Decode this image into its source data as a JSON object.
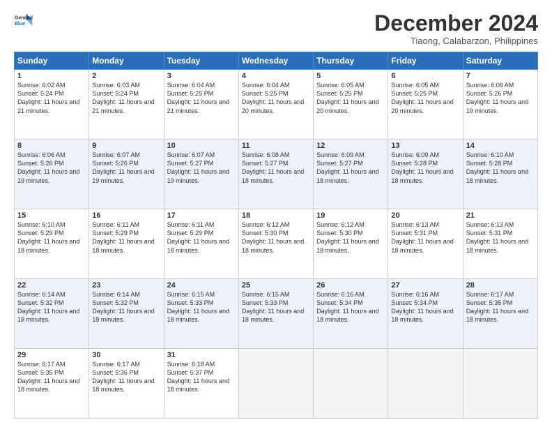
{
  "logo": {
    "line1": "General",
    "line2": "Blue"
  },
  "title": "December 2024",
  "subtitle": "Tiaong, Calabarzon, Philippines",
  "headers": [
    "Sunday",
    "Monday",
    "Tuesday",
    "Wednesday",
    "Thursday",
    "Friday",
    "Saturday"
  ],
  "weeks": [
    [
      {
        "day": "1",
        "sunrise": "6:02 AM",
        "sunset": "5:24 PM",
        "daylight": "11 hours and 21 minutes."
      },
      {
        "day": "2",
        "sunrise": "6:03 AM",
        "sunset": "5:24 PM",
        "daylight": "11 hours and 21 minutes."
      },
      {
        "day": "3",
        "sunrise": "6:04 AM",
        "sunset": "5:25 PM",
        "daylight": "11 hours and 21 minutes."
      },
      {
        "day": "4",
        "sunrise": "6:04 AM",
        "sunset": "5:25 PM",
        "daylight": "11 hours and 20 minutes."
      },
      {
        "day": "5",
        "sunrise": "6:05 AM",
        "sunset": "5:25 PM",
        "daylight": "11 hours and 20 minutes."
      },
      {
        "day": "6",
        "sunrise": "6:05 AM",
        "sunset": "5:25 PM",
        "daylight": "11 hours and 20 minutes."
      },
      {
        "day": "7",
        "sunrise": "6:06 AM",
        "sunset": "5:26 PM",
        "daylight": "11 hours and 19 minutes."
      }
    ],
    [
      {
        "day": "8",
        "sunrise": "6:06 AM",
        "sunset": "5:26 PM",
        "daylight": "11 hours and 19 minutes."
      },
      {
        "day": "9",
        "sunrise": "6:07 AM",
        "sunset": "5:26 PM",
        "daylight": "11 hours and 19 minutes."
      },
      {
        "day": "10",
        "sunrise": "6:07 AM",
        "sunset": "5:27 PM",
        "daylight": "11 hours and 19 minutes."
      },
      {
        "day": "11",
        "sunrise": "6:08 AM",
        "sunset": "5:27 PM",
        "daylight": "11 hours and 18 minutes."
      },
      {
        "day": "12",
        "sunrise": "6:09 AM",
        "sunset": "5:27 PM",
        "daylight": "11 hours and 18 minutes."
      },
      {
        "day": "13",
        "sunrise": "6:09 AM",
        "sunset": "5:28 PM",
        "daylight": "11 hours and 18 minutes."
      },
      {
        "day": "14",
        "sunrise": "6:10 AM",
        "sunset": "5:28 PM",
        "daylight": "11 hours and 18 minutes."
      }
    ],
    [
      {
        "day": "15",
        "sunrise": "6:10 AM",
        "sunset": "5:29 PM",
        "daylight": "11 hours and 18 minutes."
      },
      {
        "day": "16",
        "sunrise": "6:11 AM",
        "sunset": "5:29 PM",
        "daylight": "11 hours and 18 minutes."
      },
      {
        "day": "17",
        "sunrise": "6:11 AM",
        "sunset": "5:29 PM",
        "daylight": "11 hours and 18 minutes."
      },
      {
        "day": "18",
        "sunrise": "6:12 AM",
        "sunset": "5:30 PM",
        "daylight": "11 hours and 18 minutes."
      },
      {
        "day": "19",
        "sunrise": "6:12 AM",
        "sunset": "5:30 PM",
        "daylight": "11 hours and 18 minutes."
      },
      {
        "day": "20",
        "sunrise": "6:13 AM",
        "sunset": "5:31 PM",
        "daylight": "11 hours and 18 minutes."
      },
      {
        "day": "21",
        "sunrise": "6:13 AM",
        "sunset": "5:31 PM",
        "daylight": "11 hours and 18 minutes."
      }
    ],
    [
      {
        "day": "22",
        "sunrise": "6:14 AM",
        "sunset": "5:32 PM",
        "daylight": "11 hours and 18 minutes."
      },
      {
        "day": "23",
        "sunrise": "6:14 AM",
        "sunset": "5:32 PM",
        "daylight": "11 hours and 18 minutes."
      },
      {
        "day": "24",
        "sunrise": "6:15 AM",
        "sunset": "5:33 PM",
        "daylight": "11 hours and 18 minutes."
      },
      {
        "day": "25",
        "sunrise": "6:15 AM",
        "sunset": "5:33 PM",
        "daylight": "11 hours and 18 minutes."
      },
      {
        "day": "26",
        "sunrise": "6:16 AM",
        "sunset": "5:34 PM",
        "daylight": "11 hours and 18 minutes."
      },
      {
        "day": "27",
        "sunrise": "6:16 AM",
        "sunset": "5:34 PM",
        "daylight": "11 hours and 18 minutes."
      },
      {
        "day": "28",
        "sunrise": "6:17 AM",
        "sunset": "5:35 PM",
        "daylight": "11 hours and 18 minutes."
      }
    ],
    [
      {
        "day": "29",
        "sunrise": "6:17 AM",
        "sunset": "5:35 PM",
        "daylight": "11 hours and 18 minutes."
      },
      {
        "day": "30",
        "sunrise": "6:17 AM",
        "sunset": "5:36 PM",
        "daylight": "11 hours and 18 minutes."
      },
      {
        "day": "31",
        "sunrise": "6:18 AM",
        "sunset": "5:37 PM",
        "daylight": "11 hours and 18 minutes."
      },
      null,
      null,
      null,
      null
    ]
  ]
}
